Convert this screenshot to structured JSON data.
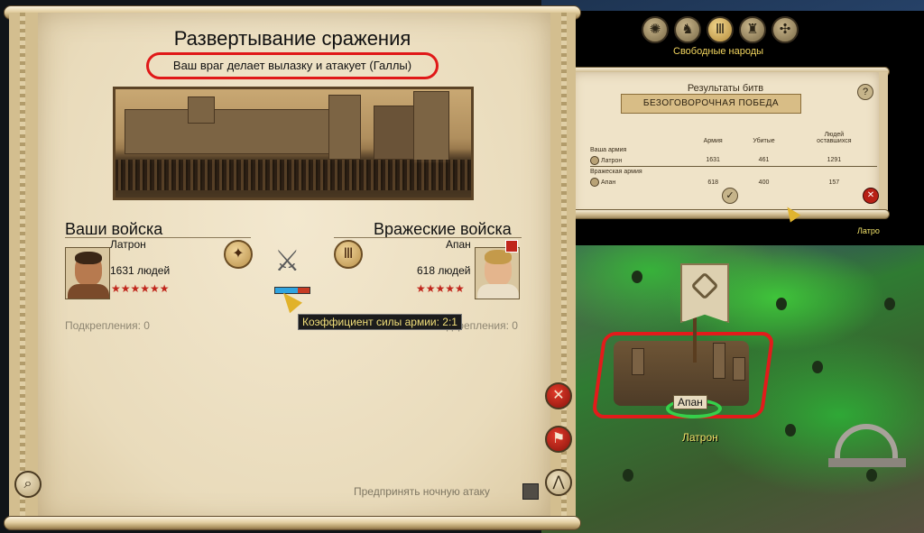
{
  "deployment": {
    "title": "Развертывание сражения",
    "subtitle": "Ваш враг делает вылазку и атакует (Галлы)",
    "player": {
      "header": "Ваши войска",
      "general": "Латрон",
      "men": "1631 людей",
      "stars": "★★★★★★",
      "reinforcements": "Подкрепления: 0"
    },
    "enemy": {
      "header": "Вражеские войска",
      "general": "Апан",
      "men": "618 людей",
      "stars": "★★★★★",
      "reinforcements": "Подкрепления: 0"
    },
    "strength_ratio_fraction": 0.67,
    "tooltip": "Коэффициент силы армии: 2:1",
    "night_attack_label": "Предпринять ночную атаку"
  },
  "faction_bar": {
    "title": "Свободные народы"
  },
  "battle_results": {
    "title": "Результаты битв",
    "banner": "БЕЗОГОВОРОЧНАЯ ПОБЕДА",
    "help": "?",
    "columns": [
      "Армия",
      "Убитые",
      "Людей",
      "оставшихся"
    ],
    "rows": [
      {
        "section": "Ваша армия",
        "name": "Латрон",
        "army": "1631",
        "killed": "461",
        "remaining": "1291"
      },
      {
        "section": "Вражеская армия",
        "name": "Апан",
        "army": "618",
        "killed": "400",
        "remaining": "157"
      }
    ]
  },
  "map": {
    "city_label": "Апан",
    "army_label": "Латрон",
    "side_label": "Латро"
  },
  "colors": {
    "highlight_red": "#e01818",
    "star_red": "#c0261c",
    "tooltip_text": "#f2df7a",
    "map_label": "#f2e36a"
  }
}
